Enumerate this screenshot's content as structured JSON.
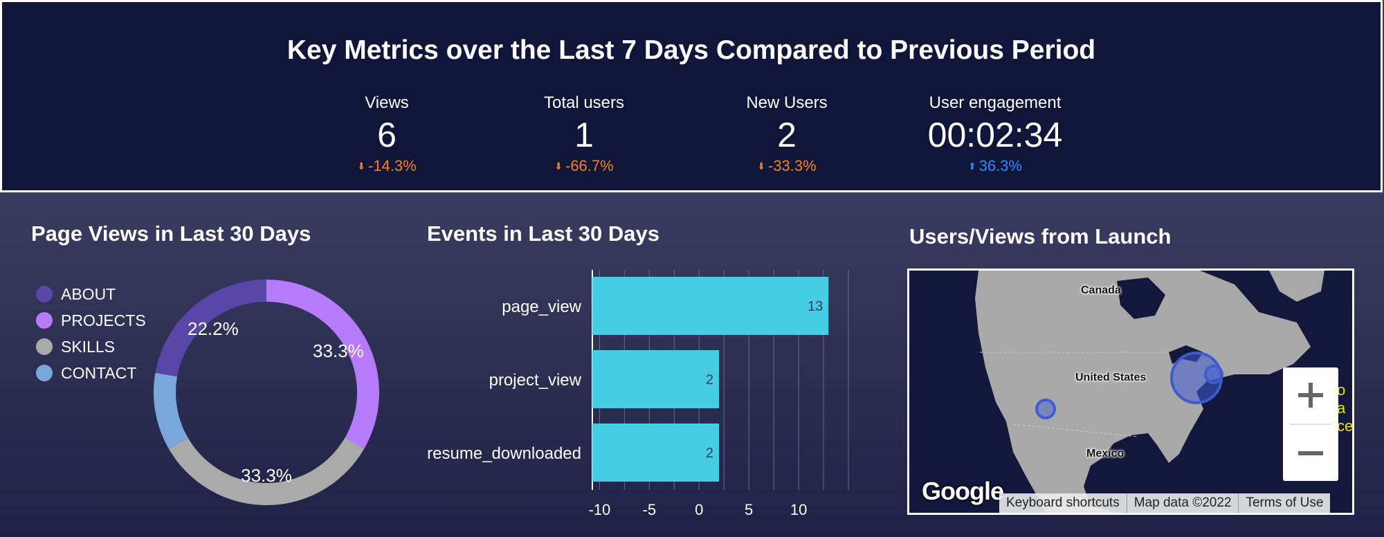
{
  "header": {
    "title": "Key Metrics over the Last 7 Days Compared to Previous Period",
    "kpis": [
      {
        "label": "Views",
        "value": "6",
        "delta": "-14.3%",
        "direction": "down"
      },
      {
        "label": "Total users",
        "value": "1",
        "delta": "-66.7%",
        "direction": "down"
      },
      {
        "label": "New Users",
        "value": "2",
        "delta": "-33.3%",
        "direction": "down"
      },
      {
        "label": "User engagement",
        "value": "00:02:34",
        "delta": "36.3%",
        "direction": "up"
      }
    ],
    "colors": {
      "down": "#f5821f",
      "up": "#2a8cff",
      "panel": "#10163a"
    }
  },
  "page_views": {
    "title": "Page Views in Last 30 Days",
    "legend": [
      {
        "label": "ABOUT",
        "color": "#5846a8"
      },
      {
        "label": "PROJECTS",
        "color": "#b57bfb"
      },
      {
        "label": "SKILLS",
        "color": "#aaaaaa"
      },
      {
        "label": "CONTACT",
        "color": "#79a7db"
      }
    ]
  },
  "events": {
    "title": "Events in Last 30 Days",
    "bar_color": "#45cde3"
  },
  "map": {
    "title": "Users/Views from Launch",
    "labels": {
      "canada": "Canada",
      "us": "United States",
      "mexico": "Mexico"
    },
    "side_text": [
      "o",
      "a",
      "ce"
    ],
    "footer": [
      "Keyboard shortcuts",
      "Map data ©2022",
      "Terms of Use"
    ],
    "logo": "Google",
    "zoom_in": "+",
    "zoom_out": "−",
    "land_color": "#a9a9a9",
    "marker_color": "#3f5bd1"
  },
  "chart_data": [
    {
      "type": "pie",
      "title": "Page Views in Last 30 Days",
      "categories": [
        "ABOUT",
        "PROJECTS",
        "SKILLS",
        "CONTACT"
      ],
      "values": [
        22.2,
        33.3,
        33.3,
        11.1
      ],
      "labels": [
        "22.2%",
        "33.3%",
        "33.3%",
        ""
      ],
      "donut": true,
      "legend": "left"
    },
    {
      "type": "bar",
      "orientation": "horizontal",
      "title": "Events in Last 30 Days",
      "categories": [
        "page_view",
        "project_view",
        "resume_downloaded"
      ],
      "values": [
        13,
        2,
        2
      ],
      "xlim": [
        -11,
        15
      ],
      "xticks": [
        -10,
        -5,
        0,
        5,
        10
      ],
      "grid": true
    }
  ]
}
